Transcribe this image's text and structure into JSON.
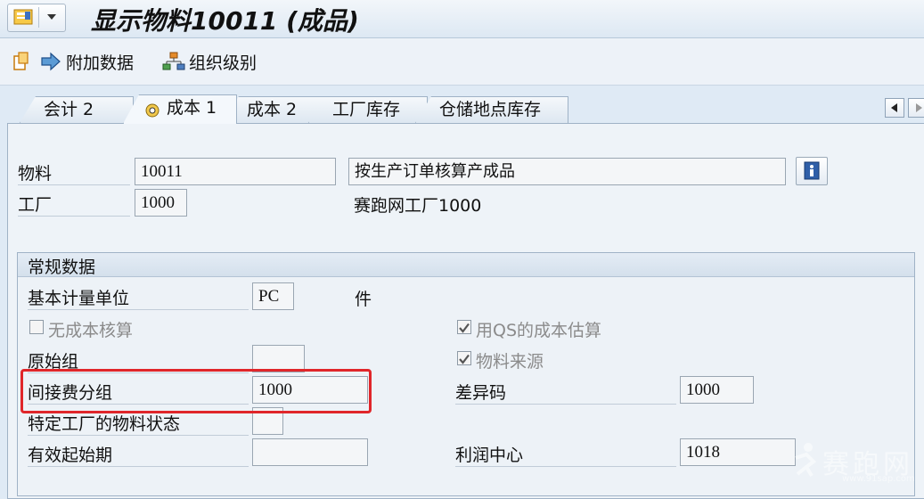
{
  "title": "显示物料10011 (成品)",
  "toolbar": {
    "additional_data": "附加数据",
    "org_levels": "组织级别"
  },
  "tabs": [
    {
      "label": "会计 2"
    },
    {
      "label": "成本 1"
    },
    {
      "label": "成本 2"
    },
    {
      "label": "工厂库存"
    },
    {
      "label": "仓储地点库存"
    }
  ],
  "header": {
    "material_label": "物料",
    "material_value": "10011",
    "material_desc": "按生产订单核算产成品",
    "plant_label": "工厂",
    "plant_value": "1000",
    "plant_desc": "赛跑网工厂1000"
  },
  "general": {
    "section_title": "常规数据",
    "base_uom_label": "基本计量单位",
    "base_uom_value": "PC",
    "base_uom_text": "件",
    "no_costing_label": "无成本核算",
    "no_costing_checked": false,
    "qs_cost_label": "用QS的成本估算",
    "qs_cost_checked": true,
    "origin_group_label": "原始组",
    "origin_group_value": "",
    "material_origin_label": "物料来源",
    "material_origin_checked": true,
    "overhead_group_label": "间接费分组",
    "overhead_group_value": "1000",
    "variance_key_label": "差异码",
    "variance_key_value": "1000",
    "plant_status_label": "特定工厂的物料状态",
    "plant_status_value": "",
    "valid_from_label": "有效起始期",
    "valid_from_value": "",
    "profit_center_label": "利润中心",
    "profit_center_value": "1018"
  },
  "watermark": {
    "text": "赛跑网",
    "url": "www.91sap.com"
  },
  "colors": {
    "highlight_border": "#e0262a",
    "background": "#dfeaf5"
  }
}
